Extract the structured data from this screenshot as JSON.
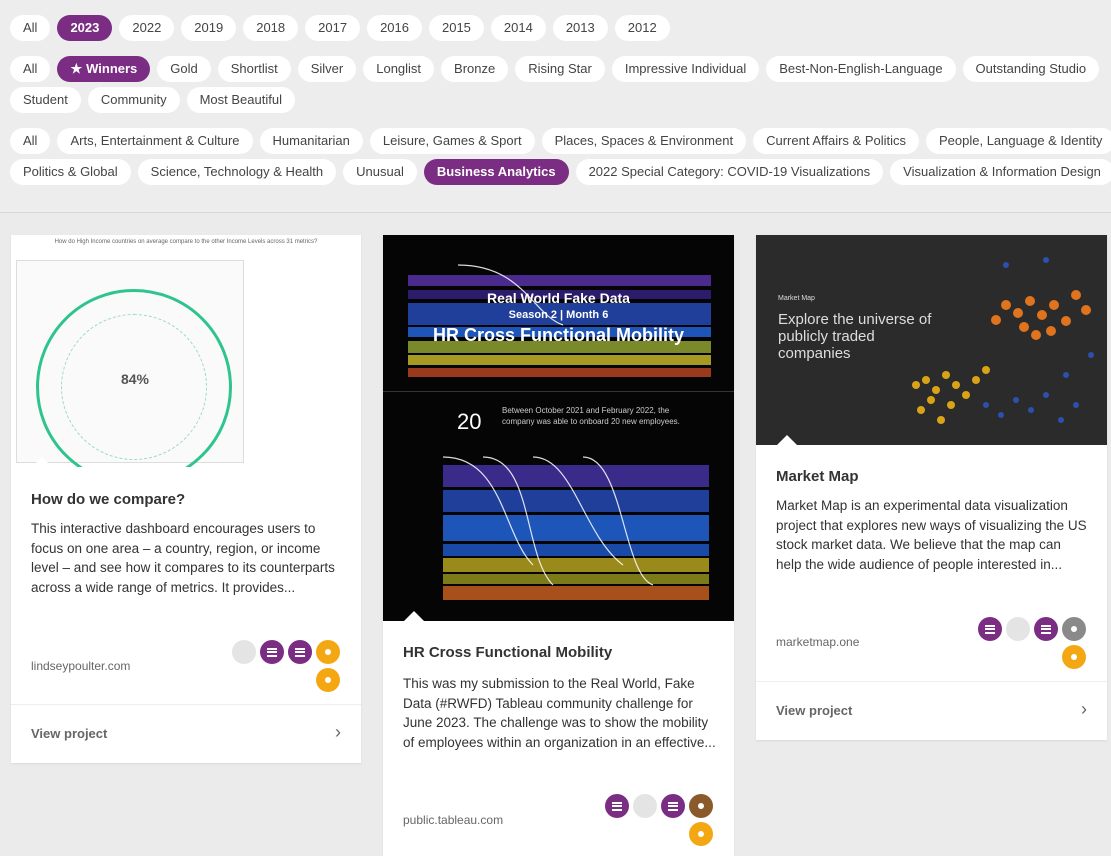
{
  "filters": {
    "years": [
      {
        "label": "All",
        "active": false
      },
      {
        "label": "2023",
        "active": true
      },
      {
        "label": "2022",
        "active": false
      },
      {
        "label": "2019",
        "active": false
      },
      {
        "label": "2018",
        "active": false
      },
      {
        "label": "2017",
        "active": false
      },
      {
        "label": "2016",
        "active": false
      },
      {
        "label": "2015",
        "active": false
      },
      {
        "label": "2014",
        "active": false
      },
      {
        "label": "2013",
        "active": false
      },
      {
        "label": "2012",
        "active": false
      }
    ],
    "awards_row1": [
      "All",
      "Winners",
      "Gold",
      "Shortlist",
      "Silver",
      "Longlist",
      "Bronze",
      "Rising Star",
      "Impressive Individual",
      "Best-Non-English-Language",
      "Outstanding Studio"
    ],
    "awards_row2": [
      "Student",
      "Community",
      "Most Beautiful"
    ],
    "awards_active": "Winners",
    "categories_row1": [
      "All",
      "Arts, Entertainment & Culture",
      "Humanitarian",
      "Leisure, Games & Sport",
      "Places, Spaces & Environment",
      "Current Affairs & Politics",
      "People, Language & Identity"
    ],
    "categories_row2": [
      "Politics & Global",
      "Science, Technology & Health",
      "Unusual",
      "Business Analytics",
      "2022 Special Category: COVID-19 Visualizations",
      "Visualization & Information Design"
    ],
    "categories_active": "Business Analytics"
  },
  "cards": [
    {
      "title": "How do we compare?",
      "description": "This interactive dashboard encourages users to focus on one area – a country, region, or income level – and see how it compares to its counterparts across a wide range of metrics. It provides...",
      "source": "lindseypoulter.com",
      "view_label": "View project",
      "thumb_header": "How do  High Income  countries on average compare to the other  Income Levels  across 31 metrics?",
      "thumb_pct": "84%",
      "badges": [
        "gray",
        "purple-lines",
        "purple-lines",
        "gold",
        "gold"
      ]
    },
    {
      "title": "HR Cross Functional Mobility",
      "description": "This was my submission to the Real World, Fake Data (#RWFD) Tableau community challenge for June 2023. The challenge was to show the mobility of employees within an organization in an effective...",
      "source": "public.tableau.com",
      "view_label": "View project",
      "thumb_line1": "Real World Fake Data",
      "thumb_line2": "Season 2 | Month 6",
      "thumb_line3": "HR Cross Functional Mobility",
      "thumb_num": "20",
      "thumb_note": "Between October 2021 and February 2022, the company was able to onboard 20 new employees.",
      "badges": [
        "purple-lines",
        "gray",
        "purple-lines",
        "bronze",
        "gold"
      ]
    },
    {
      "title": "Market Map",
      "description": "Market Map is an experimental data visualization project that explores new ways of visualizing the US stock market data. We believe that the map can help the wide audience of people interested in...",
      "source": "marketmap.one",
      "view_label": "View project",
      "thumb_label": "Market Map",
      "thumb_heading": "Explore the universe of publicly traded companies",
      "badges": [
        "purple-lines",
        "gray",
        "purple-lines",
        "dgray",
        "gold"
      ]
    }
  ],
  "colors": {
    "accent": "#7b2c83",
    "gold": "#f3a712",
    "bronze": "#8a5a2b",
    "ring": "#2fc48d"
  }
}
